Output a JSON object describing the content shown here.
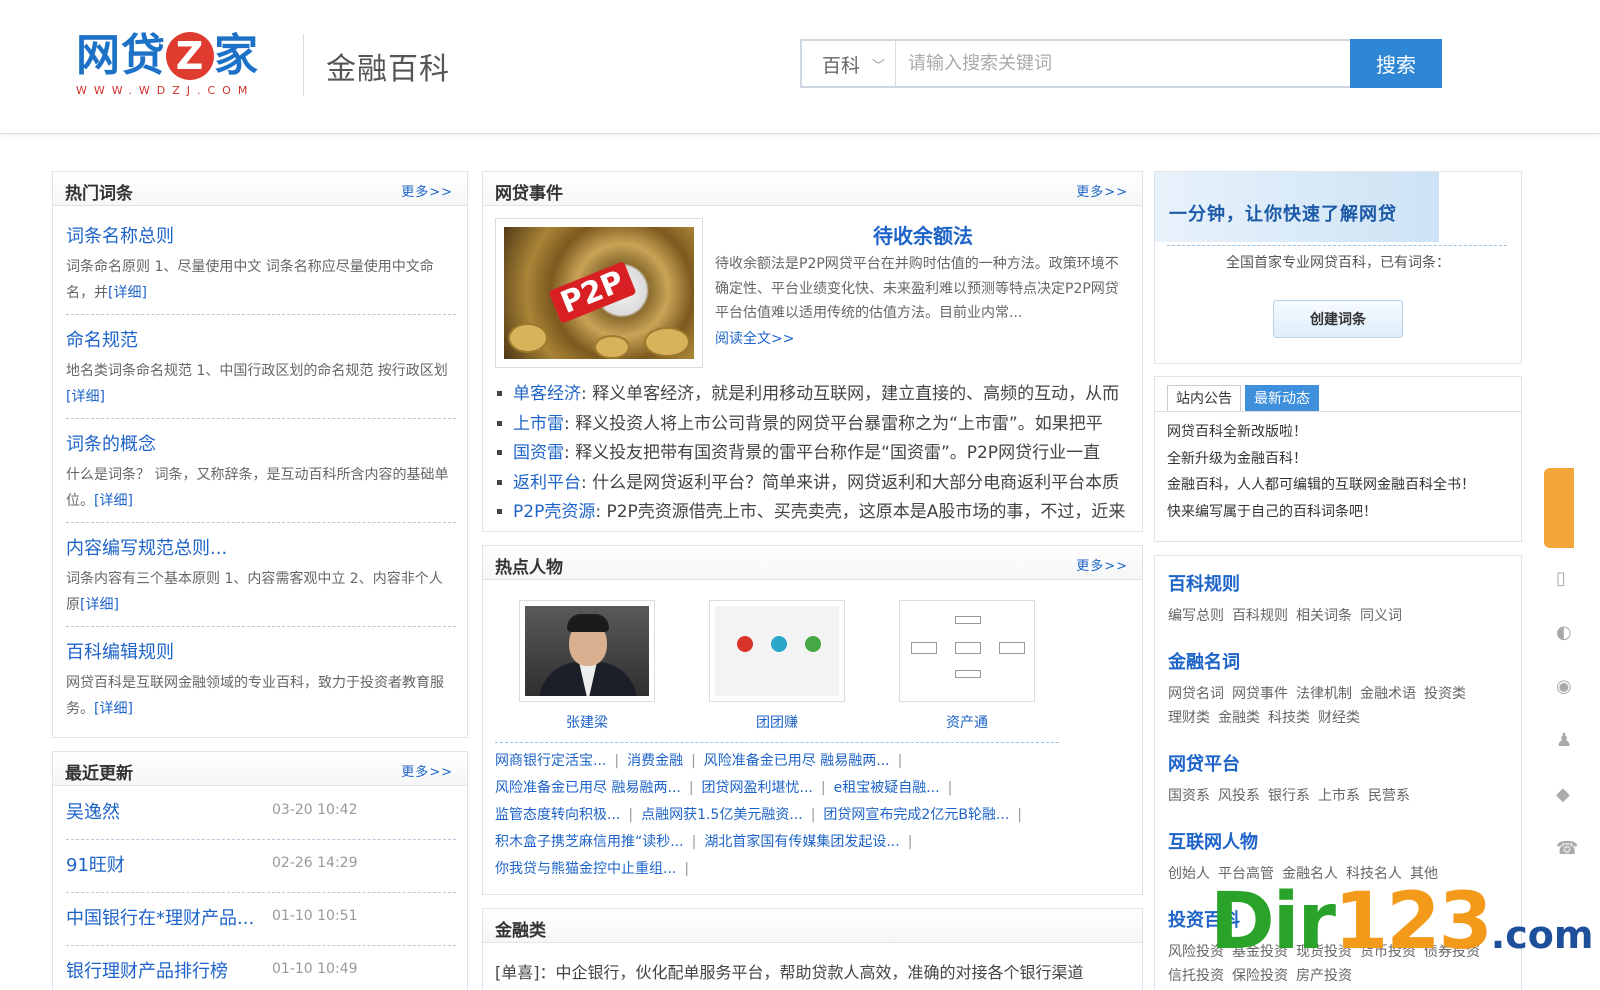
{
  "header": {
    "logo_text_a": "网贷",
    "logo_text_z": "Z",
    "logo_text_b": "家",
    "logo_domain": "WWW.WDZJ.COM",
    "page_title": "金融百科",
    "search": {
      "category": "百科",
      "placeholder": "请输入搜索关键词",
      "button": "搜索"
    }
  },
  "hot_entries": {
    "title": "热门词条",
    "more": "更多>>",
    "items": [
      {
        "title": "词条名称总则",
        "desc": "词条命名原则 1、尽量使用中文 词条名称应尽量使用中文命名，并",
        "detail": "[详细]"
      },
      {
        "title": "命名规范",
        "desc": "地名类词条命名规范 1、中国行政区划的命名规范 按行政区划",
        "detail": "[详细]"
      },
      {
        "title": "词条的概念",
        "desc": "什么是词条？ 词条，又称辞条，是互动百科所含内容的基础单位。",
        "detail": "[详细]"
      },
      {
        "title": "内容编写规范总则...",
        "desc": "词条内容有三个基本原则 1、内容需客观中立 2、内容非个人原",
        "detail": "[详细]"
      },
      {
        "title": "百科编辑规则",
        "desc": "网贷百科是互联网金融领域的专业百科，致力于投资者教育服务。",
        "detail": "[详细]"
      }
    ]
  },
  "recent": {
    "title": "最近更新",
    "more": "更多>>",
    "items": [
      {
        "name": "吴逸然",
        "time": "03-20 10:42"
      },
      {
        "name": "91旺财",
        "time": "02-26 14:29"
      },
      {
        "name": "中国银行在*理财产品...",
        "time": "01-10 10:51"
      },
      {
        "name": "银行理财产品排行榜",
        "time": "01-10 10:49"
      }
    ]
  },
  "events": {
    "title": "网贷事件",
    "more": "更多>>",
    "image_label": "P2P",
    "feature_title": "待收余额法",
    "feature_desc": "待收余额法是P2P网贷平台在并购时估值的一种方法。政策环境不确定性、平台业绩变化快、未来盈利难以预测等特点决定P2P网贷平台估值难以适用传统的估值方法。目前业内常...",
    "feature_more": "阅读全文>>",
    "news": [
      {
        "term": "单客经济",
        "text": ": 释义单客经济，就是利用移动互联网，建立直接的、高频的互动，从而"
      },
      {
        "term": "上市雷",
        "text": ": 释义投资人将上市公司背景的网贷平台暴雷称之为“上市雷”。如果把平"
      },
      {
        "term": "国资雷",
        "text": ": 释义投友把带有国资背景的雷平台称作是“国资雷”。P2P网贷行业一直"
      },
      {
        "term": "返利平台",
        "text": ": 什么是网贷返利平台？简单来讲，网贷返利和大部分电商返利平台本质"
      },
      {
        "term": "P2P壳资源",
        "text": ": P2P壳资源借壳上市、买壳卖壳，这原本是A股市场的事，不过，近来"
      }
    ]
  },
  "people": {
    "title": "热点人物",
    "more": "更多>>",
    "items": [
      {
        "name": "张建梁"
      },
      {
        "name": "团团赚"
      },
      {
        "name": "资产通"
      }
    ],
    "links": [
      [
        "网商银行定活宝...",
        "消费金融",
        "风险准备金已用尽 融易融两..."
      ],
      [
        "风险准备金已用尽 融易融两...",
        "团贷网盈利堪忧...",
        "e租宝被疑自融..."
      ],
      [
        "监管态度转向积极...",
        "点融网获1.5亿美元融资...",
        "团贷网宣布完成2亿元B轮融..."
      ],
      [
        "积木盒子携芝麻信用推“读秒...",
        "湖北首家国有传媒集团发起设..."
      ],
      [
        "你我贷与熊猫金控中止重组..."
      ]
    ]
  },
  "finance": {
    "title": "金融类",
    "first_line": "[单喜]：中企银行，伙化配单服务平台，帮助贷款人高效，准确的对接各个银行渠道"
  },
  "intro": {
    "banner": "一分钟，让你快速了解网贷",
    "text": "全国首家专业网贷百科，已有词条：",
    "button": "创建词条"
  },
  "announce": {
    "tabs": [
      "站内公告",
      "最新动态"
    ],
    "lines": [
      "网贷百科全新改版啦！",
      "全新升级为金融百科！",
      "金融百科，人人都可编辑的互联网金融百科全书！",
      "快来编写属于自己的百科词条吧！"
    ]
  },
  "categories": [
    {
      "title": "百科规则",
      "items": [
        "编写总则",
        "百科规则",
        "相关词条",
        "同义词"
      ]
    },
    {
      "title": "金融名词",
      "items": [
        "网贷名词",
        "网贷事件",
        "法律机制",
        "金融术语",
        "投资类",
        "理财类",
        "金融类",
        "科技类",
        "财经类"
      ]
    },
    {
      "title": "网贷平台",
      "items": [
        "国资系",
        "风投系",
        "银行系",
        "上市系",
        "民营系"
      ]
    },
    {
      "title": "互联网人物",
      "items": [
        "创始人",
        "平台高管",
        "金融名人",
        "科技名人",
        "其他"
      ]
    },
    {
      "title": "投资百科",
      "items": [
        "风险投资",
        "基金投资",
        "现货投资",
        "货币投资",
        "债券投资",
        "信托投资",
        "保险投资",
        "房产投资"
      ]
    }
  ],
  "watermark": {
    "d": "Dir",
    "n": "123",
    "c": ".com"
  }
}
